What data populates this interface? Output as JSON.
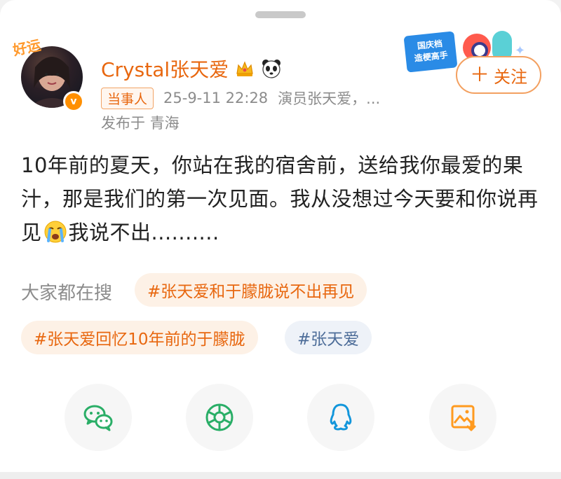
{
  "header": {
    "username": "Crystal张天爱",
    "tag": "当事人",
    "timestamp": "25-9-11 22:28",
    "verification": "演员张天爱，...",
    "location_prefix": "发布于",
    "location": "青海",
    "avatar_badge": "好运",
    "verified_mark": "v"
  },
  "sticker": {
    "line1": "国庆档",
    "line2": "造梗高手"
  },
  "follow_button": {
    "plus": "＋",
    "label": "关注"
  },
  "post": {
    "text_before_emoji": "10年前的夏天，你站在我的宿舍前，送给我你最爱的果汁，那是我们的第一次见面。我从没想过今天要和你说再见",
    "text_after_emoji": "我说不出..........",
    "emoji": "cry-emoji"
  },
  "hot_search": {
    "label": "大家都在搜",
    "chips": [
      "#张天爱和于朦胧说不出再见",
      "#张天爱回忆10年前的于朦胧",
      "#张天爱"
    ]
  },
  "share": {
    "icons": [
      "wechat-icon",
      "moments-icon",
      "qq-icon",
      "save-image-icon"
    ]
  },
  "colors": {
    "accent": "#e8670f",
    "wechat": "#2aae67",
    "qq": "#1296db",
    "save": "#ff9a1f"
  }
}
